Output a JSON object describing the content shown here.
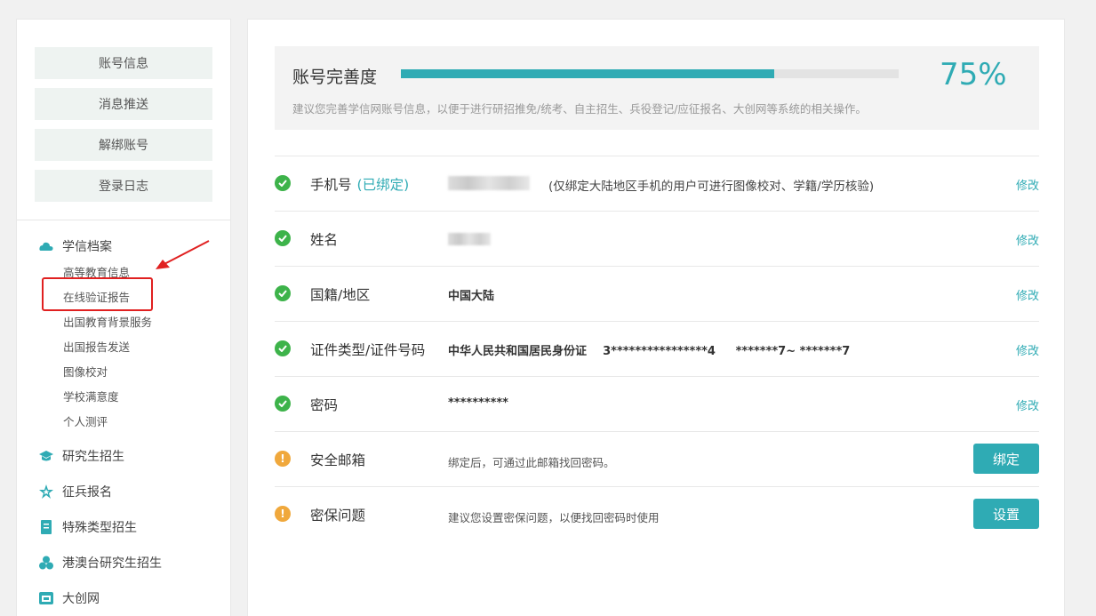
{
  "sidebar": {
    "buttons": [
      "账号信息",
      "消息推送",
      "解绑账号",
      "登录日志"
    ],
    "categories": [
      {
        "label": "学信档案",
        "icon": "cloud-icon"
      },
      {
        "label": "研究生招生",
        "icon": "graduation-cap-icon"
      },
      {
        "label": "征兵报名",
        "icon": "star-badge-icon"
      },
      {
        "label": "特殊类型招生",
        "icon": "book-icon"
      },
      {
        "label": "港澳台研究生招生",
        "icon": "cluster-icon"
      },
      {
        "label": "大创网",
        "icon": "window-icon"
      }
    ],
    "sub_items": [
      "高等教育信息",
      "在线验证报告",
      "出国教育背景服务",
      "出国报告发送",
      "图像校对",
      "学校满意度",
      "个人测评"
    ]
  },
  "progress": {
    "title": "账号完善度",
    "percent_text": "75%",
    "percent": 0.75,
    "hint": "建议您完善学信网账号信息，以便于进行研招推免/统考、自主招生、兵役登记/应征报名、大创网等系统的相关操作。"
  },
  "rows": [
    {
      "status": "ok",
      "label": "手机号",
      "tag": "(已绑定)",
      "note": "(仅绑定大陆地区手机的用户可进行图像校对、学籍/学历核验)",
      "edit": "修改"
    },
    {
      "status": "ok",
      "label": "姓名",
      "edit": "修改"
    },
    {
      "status": "ok",
      "label": "国籍/地区",
      "value": "中国大陆",
      "edit": "修改"
    },
    {
      "status": "ok",
      "label": "证件类型/证件号码",
      "value": "中华人民共和国居民身份证    3****************4     *******7~ *******7",
      "edit": "修改"
    },
    {
      "status": "ok",
      "label": "密码",
      "value": "**********",
      "edit": "修改"
    },
    {
      "status": "warn",
      "label": "安全邮箱",
      "desc": "绑定后，可通过此邮箱找回密码。",
      "action": "绑定"
    },
    {
      "status": "warn",
      "label": "密保问题",
      "desc": "建议您设置密保问题，以便找回密码时使用",
      "action": "设置"
    }
  ],
  "colors": {
    "accent": "#2fabb4",
    "ok": "#3db34a",
    "warn": "#f0a83c",
    "annotation": "#e02020"
  }
}
